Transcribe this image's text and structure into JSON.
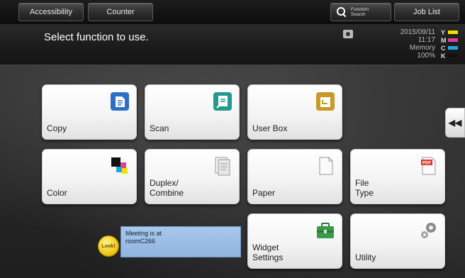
{
  "topbar": {
    "accessibility_label": "Accessibility",
    "counter_label": "Counter",
    "function_search_label_line1": "Function",
    "function_search_label_line2": "Search",
    "job_list_label": "Job List"
  },
  "header": {
    "message": "Select function to use.",
    "date": "2015/09/11",
    "time": "11:17",
    "memory_label": "Memory",
    "memory_value": "100%",
    "toner": [
      {
        "letter": "Y",
        "color": "#f2e200"
      },
      {
        "letter": "M",
        "color": "#e0409a"
      },
      {
        "letter": "C",
        "color": "#22a6e0"
      },
      {
        "letter": "K",
        "color": "#111111"
      }
    ]
  },
  "tiles": {
    "copy": "Copy",
    "scan": "Scan",
    "user_box": "User Box",
    "color": "Color",
    "duplex_combine": "Duplex/\nCombine",
    "paper": "Paper",
    "file_type": "File\nType",
    "widget_settings": "Widget\nSettings",
    "utility": "Utility"
  },
  "widget": {
    "note_text": "Meeting is at\nroomC266",
    "badge_text": "Look!"
  },
  "side_button_label": "◀◀"
}
